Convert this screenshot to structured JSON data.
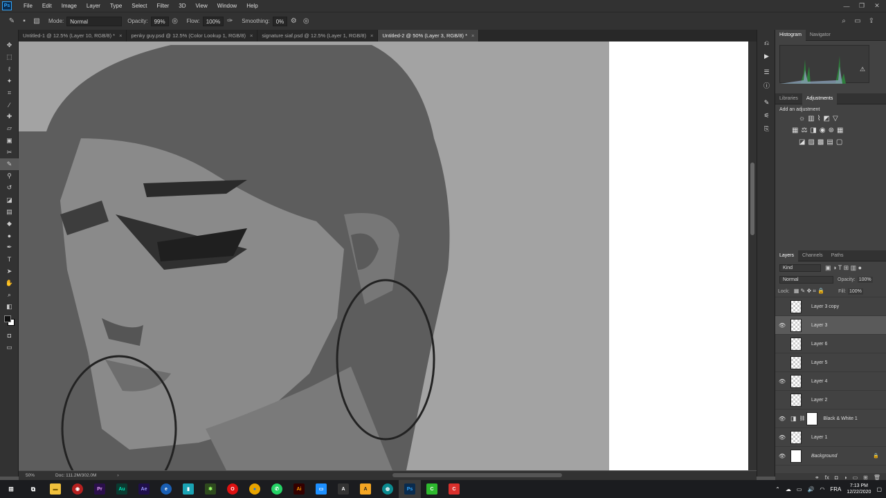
{
  "menu": [
    "File",
    "Edit",
    "Image",
    "Layer",
    "Type",
    "Select",
    "Filter",
    "3D",
    "View",
    "Window",
    "Help"
  ],
  "options": {
    "mode_label": "Mode:",
    "mode_value": "Normal",
    "opacity_label": "Opacity:",
    "opacity_value": "99%",
    "flow_label": "Flow:",
    "flow_value": "100%",
    "smoothing_label": "Smoothing:",
    "smoothing_value": "0%"
  },
  "tabs": [
    {
      "label": "Untitled-1 @ 12.5% (Layer 10, RGB/8) *"
    },
    {
      "label": "penky guy.psd @ 12.5% (Color Lookup 1, RGB/8)"
    },
    {
      "label": "signature siaf.psd @ 12.5% (Layer 1, RGB/8)"
    },
    {
      "label": "Untitled-2 @ 50% (Layer 3, RGB/8) *"
    }
  ],
  "status": {
    "zoom": "50%",
    "doc": "Doc: 111.2M/302.0M"
  },
  "histogram": {
    "tabs": [
      "Histogram",
      "Navigator"
    ]
  },
  "adjustments": {
    "tabs": [
      "Libraries",
      "Adjustments"
    ],
    "heading": "Add an adjustment"
  },
  "layers": {
    "tabs": [
      "Layers",
      "Channels",
      "Paths"
    ],
    "kind": "Kind",
    "blend": "Normal",
    "opacity_label": "Opacity:",
    "opacity": "100%",
    "lock_label": "Lock:",
    "fill_label": "Fill:",
    "fill": "100%",
    "items": [
      {
        "name": "Layer 3 copy",
        "visible": false
      },
      {
        "name": "Layer 3",
        "visible": true
      },
      {
        "name": "Layer 6",
        "visible": false
      },
      {
        "name": "Layer 5",
        "visible": false
      },
      {
        "name": "Layer 4",
        "visible": true
      },
      {
        "name": "Layer 2",
        "visible": false
      },
      {
        "name": "Black & White 1",
        "visible": true
      },
      {
        "name": "Layer 1",
        "visible": true
      },
      {
        "name": "Background",
        "visible": true
      }
    ]
  },
  "clock": {
    "time": "7:13 PM",
    "date": "12/22/2020",
    "lang": "FRA"
  },
  "colors": {
    "accent": "#31a8ff",
    "panel": "#535353",
    "dark": "#323232",
    "canvas": "#a3a3a3"
  }
}
